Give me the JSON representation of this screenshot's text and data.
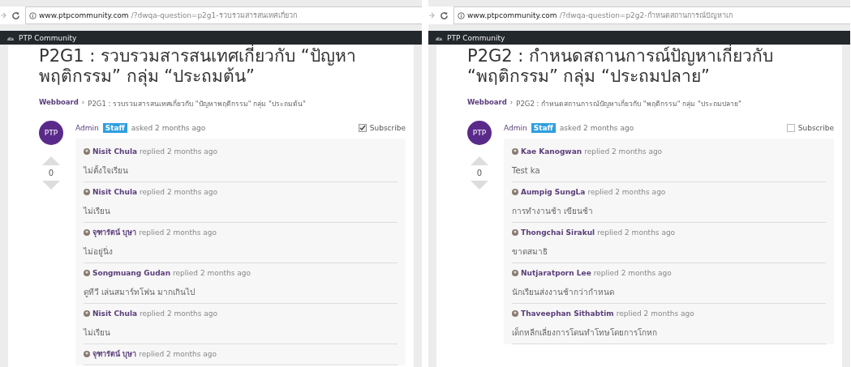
{
  "panels": [
    {
      "browser": {
        "url_host": "www.ptpcommunity.com",
        "url_path": "/?dwqa-question=p2g1-รวบรวมสารสนเทศเกี่ยวก"
      },
      "admin_bar": {
        "site_name": "PTP Community"
      },
      "question": {
        "title": "P2G1 : รวบรวมสารสนเทศเกี่ยวกับ “ปัญหาพฤติกรรม” กลุ่ม “ประถมต้น”",
        "breadcrumb_link": "Webboard",
        "breadcrumb_separator": "›",
        "breadcrumb_current": "P2G1 : รวบรวมสารสนเทศเกี่ยวกับ \"ปัญหาพฤติกรรม\" กลุ่ม \"ประถมต้น\"",
        "avatar_text": "PTP",
        "author": "Admin",
        "role_badge": "Staff",
        "asked": "asked 2 months ago",
        "subscribe": {
          "label": "Subscribe",
          "checked": true
        },
        "votes": "0"
      },
      "replies": [
        {
          "author": "Nisit Chula",
          "meta": "replied 2 months ago",
          "body": "ไม่ตั้งใจเรียน"
        },
        {
          "author": "Nisit Chula",
          "meta": "replied 2 months ago",
          "body": "ไม่เรียน"
        },
        {
          "author": "จุฑารัตน์ บุษา",
          "meta": "replied 2 months ago",
          "body": "ไม่อยู่นิ่ง"
        },
        {
          "author": "Songmuang Gudan",
          "meta": "replied 2 months ago",
          "body": "ดูทีวี เล่นสมาร์ทโฟน มากเกินไป"
        },
        {
          "author": "Nisit Chula",
          "meta": "replied 2 months ago",
          "body": "ไม่เรียน"
        },
        {
          "author": "จุฑารัตน์ บุษา",
          "meta": "replied 2 months ago"
        }
      ]
    },
    {
      "browser": {
        "url_host": "www.ptpcommunity.com",
        "url_path": "/?dwqa-question=p2g2-กำหนดสถานการณ์ปัญหาเก"
      },
      "admin_bar": {
        "site_name": "PTP Community"
      },
      "question": {
        "title": "P2G2 : กำหนดสถานการณ์ปัญหาเกี่ยวกับ “พฤติกรรม” กลุ่ม “ประถมปลาย”",
        "breadcrumb_link": "Webboard",
        "breadcrumb_separator": "›",
        "breadcrumb_current": "P2G2 : กำหนดสถานการณ์ปัญหาเกี่ยวกับ \"พฤติกรรม\" กลุ่ม \"ประถมปลาย\"",
        "avatar_text": "PTP",
        "author": "Admin",
        "role_badge": "Staff",
        "asked": "asked 2 months ago",
        "subscribe": {
          "label": "Subscribe",
          "checked": false
        },
        "votes": "0"
      },
      "replies": [
        {
          "author": "Kae Kanogwan",
          "meta": "replied 2 months ago",
          "body": "Test ka"
        },
        {
          "author": "Aumpig SungLa",
          "meta": "replied 2 months ago",
          "body": "การทำงานช้า เขียนช้า"
        },
        {
          "author": "Thongchai Sirakul",
          "meta": "replied 2 months ago",
          "body": "ขาดสมาธิ"
        },
        {
          "author": "Nutjaratporn Lee",
          "meta": "replied 2 months ago",
          "body": "นักเรียนส่งงานช้ากว่ากำหนด"
        },
        {
          "author": "Thaveephan Sithabtim",
          "meta": "replied 2 months ago",
          "body": "เด็กหลีกเลี่ยงการโดนทำโทษโดยการโกหก"
        }
      ]
    }
  ]
}
